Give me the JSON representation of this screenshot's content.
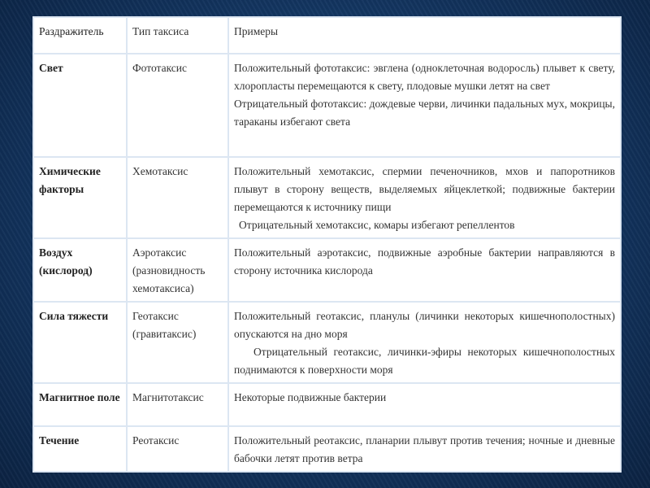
{
  "header": [
    "Раздражитель",
    "Тип таксиса",
    "Примеры"
  ],
  "rows": [
    {
      "stimulus": "Свет",
      "type": "Фототаксис",
      "examples": [
        "Положительный фототаксис: эвглена (одноклеточная водоросль) плывет к свету, хлоропласты перемещаются к свету, плодовые мушки летят на свет",
        "Отрицательный фототаксис: дождевые черви, личинки падальных мух, мокрицы, тараканы избегают света"
      ]
    },
    {
      "stimulus": "Химические факторы",
      "type": "Хемотаксис",
      "examples": [
        "Положительный хемотаксис, спермии печеночников, мхов и папоротников плывут в сторону веществ, выделяемых яйцеклеткой; подвижные бактерии перемещаются к источнику пищи",
        "Отрицательный хемотаксис, комары избегают репеллентов"
      ]
    },
    {
      "stimulus": "Воздух (кислород)",
      "type": "Аэротаксис (разновидность хемотаксиса)",
      "examples": [
        "Положительный аэротаксис, подвижные аэробные бактерии направляются в сторону источника кислорода"
      ]
    },
    {
      "stimulus": "Сила тяжести",
      "type": "Геотаксис (гравитаксис)",
      "examples": [
        "Положительный геотаксис, планулы (личинки некоторых кишечнополостных) опускаются на дно моря",
        "Отрицательный геотаксис, личинки-эфиры некоторых кишечнополостных поднимаются к поверхности моря"
      ]
    },
    {
      "stimulus": "Магнитное поле",
      "type": "Магнитотаксис",
      "examples": [
        "Некоторые подвижные бактерии"
      ]
    },
    {
      "stimulus": "Течение",
      "type": "Реотаксис",
      "examples": [
        "Положительный реотаксис, планарии плывут против течения; ночные и дневные бабочки летят против ветра"
      ]
    }
  ]
}
